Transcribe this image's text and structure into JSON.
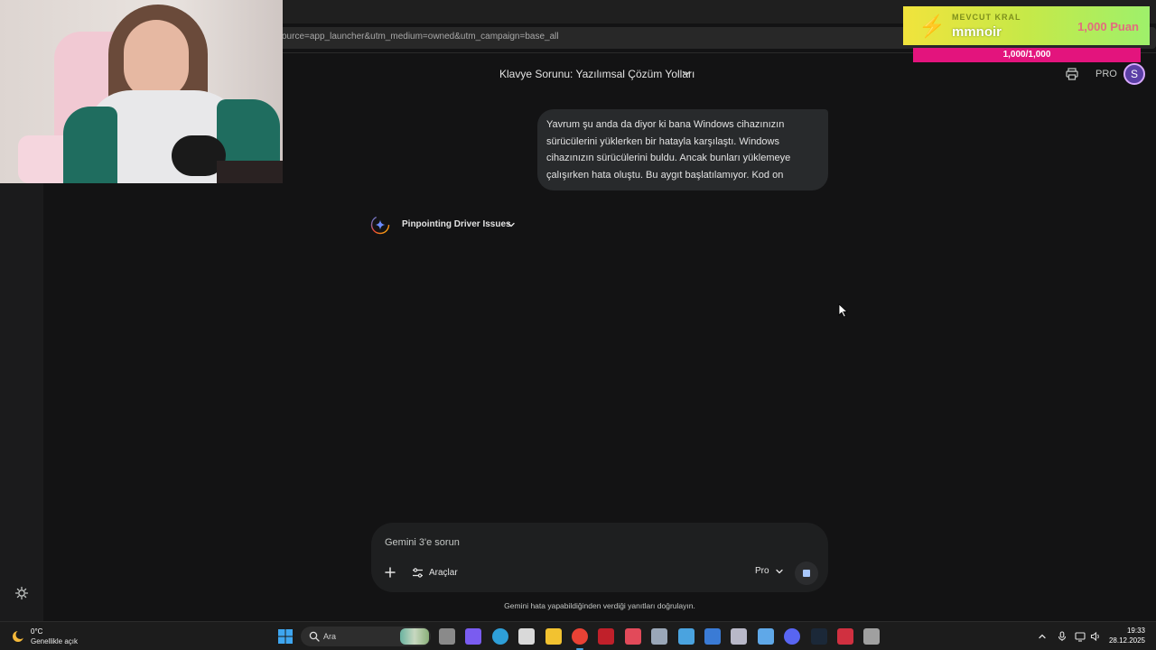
{
  "browser": {
    "url_fragment": "ource=app_launcher&utm_medium=owned&utm_campaign=base_all"
  },
  "overlay": {
    "label": "MEVCUT KRAL",
    "name": "mmnoir",
    "points": "1,000 Puan",
    "bar_text": "1,000/1,000",
    "bar_progress": 1.0
  },
  "header": {
    "conversation_title": "Klavye Sorunu: Yazılımsal Çözüm Yolları",
    "pro_label": "PRO",
    "avatar_initial": "S"
  },
  "chat": {
    "user_message": "Yavrum şu anda da diyor ki bana Windows cihazınızın sürücülerini yüklerken bir hatayla karşılaştı. Windows cihazınızın sürücülerini buldu. Ancak bunları yüklemeye çalışırken hata oluştu. Bu aygıt başlatılamıyor. Kod on",
    "thinking_label": "Pinpointing Driver Issues"
  },
  "composer": {
    "placeholder": "Gemini 3'e sorun",
    "tools_label": "Araçlar",
    "model_label": "Pro",
    "disclaimer": "Gemini hata yapabildiğinden verdiği yanıtları doğrulayın."
  },
  "taskbar": {
    "weather_temp": "0°C",
    "weather_desc": "Genellikle açık",
    "search_label": "Ara",
    "time": "19:33",
    "date": "28.12.2025",
    "apps": [
      {
        "name": "task-view-icon",
        "color": "#8a8a8a"
      },
      {
        "name": "copilot-icon",
        "color": "#7a5cf0"
      },
      {
        "name": "edge-icon",
        "color": "#2e9fd8"
      },
      {
        "name": "store-icon",
        "color": "#d9d9d9"
      },
      {
        "name": "file-explorer-icon",
        "color": "#f2c230"
      },
      {
        "name": "chrome-icon",
        "color": "#e94235"
      },
      {
        "name": "app-red-icon",
        "color": "#c0202a"
      },
      {
        "name": "app-game-icon",
        "color": "#e24a5a"
      },
      {
        "name": "settings-icon",
        "color": "#9aa7b8"
      },
      {
        "name": "app-window-icon",
        "color": "#4aa3df"
      },
      {
        "name": "steam-app-icon",
        "color": "#3a7bd5"
      },
      {
        "name": "app-shield-icon",
        "color": "#b8b8c8"
      },
      {
        "name": "notepad-icon",
        "color": "#5fa8e8"
      },
      {
        "name": "discord-icon",
        "color": "#5865f2"
      },
      {
        "name": "steam-icon",
        "color": "#1b2838"
      },
      {
        "name": "app-doc-icon",
        "color": "#d03040"
      },
      {
        "name": "app-gray-icon",
        "color": "#a0a0a0"
      }
    ]
  }
}
